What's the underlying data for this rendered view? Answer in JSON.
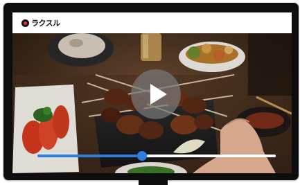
{
  "app": {
    "logo_text": "ラクスル"
  },
  "player": {
    "progress_fraction": 0.44,
    "accent_color": "#2f7de1",
    "play_icon": "play-icon"
  }
}
